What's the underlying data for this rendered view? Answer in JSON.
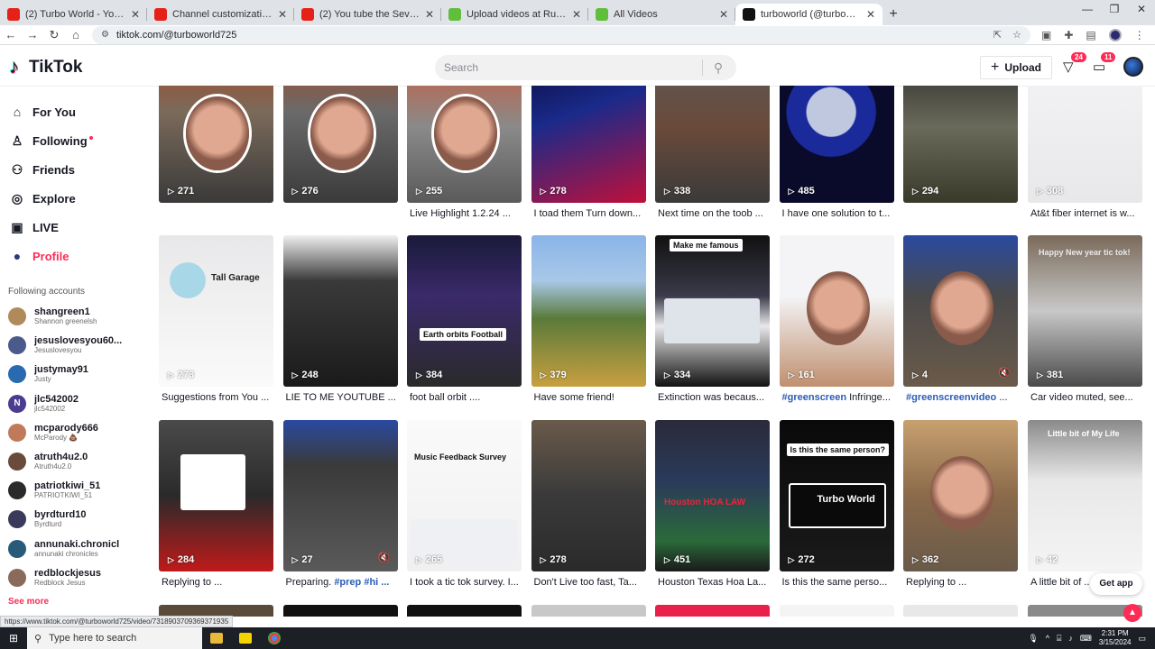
{
  "browser": {
    "tabs": [
      {
        "title": "(2) Turbo World - YouTube",
        "color": "#e62117"
      },
      {
        "title": "Channel customization - YouTube",
        "color": "#e62117"
      },
      {
        "title": "(2) You tube the Severe alcohol",
        "color": "#e62117"
      },
      {
        "title": "Upload videos at Rumble",
        "color": "#5fbf3c"
      },
      {
        "title": "All Videos",
        "color": "#5fbf3c"
      },
      {
        "title": "turboworld (@turboworld725) | TikTok",
        "color": "#111111"
      }
    ],
    "active_tab": 5,
    "url": "tiktok.com/@turboworld725"
  },
  "header": {
    "logo": "TikTok",
    "search_placeholder": "Search",
    "upload_label": "Upload",
    "inbox_badge": "24",
    "messages_badge": "11"
  },
  "sidebar": {
    "nav": [
      {
        "label": "For You",
        "icon": "home-icon"
      },
      {
        "label": "Following",
        "icon": "following-icon"
      },
      {
        "label": "Friends",
        "icon": "friends-icon"
      },
      {
        "label": "Explore",
        "icon": "compass-icon"
      },
      {
        "label": "LIVE",
        "icon": "live-icon"
      },
      {
        "label": "Profile",
        "icon": "profile-icon"
      }
    ],
    "following_title": "Following accounts",
    "accounts": [
      {
        "name": "shangreen1",
        "sub": "Shannon greenelsh",
        "color": "#b08a5a"
      },
      {
        "name": "jesuslovesyou60...",
        "sub": "Jesuslovesyou",
        "color": "#4a5a8a"
      },
      {
        "name": "justymay91",
        "sub": "Justy",
        "color": "#2a6ab0"
      },
      {
        "name": "jlc542002",
        "sub": "jlc542002",
        "color": "#4b3c8f",
        "initial": "N"
      },
      {
        "name": "mcparody666",
        "sub": "McParody 💩",
        "color": "#c07a5a"
      },
      {
        "name": "atruth4u2.0",
        "sub": "Atruth4u2.0",
        "color": "#6a4a3a"
      },
      {
        "name": "patriotkiwi_51",
        "sub": "PATRIOTKIWI_51",
        "color": "#2a2a2a"
      },
      {
        "name": "byrdturd10",
        "sub": "Byrdturd",
        "color": "#3a3a5a"
      },
      {
        "name": "annunaki.chronicl",
        "sub": "annunaki chronicles",
        "color": "#2a5a7a"
      },
      {
        "name": "redblockjesus",
        "sub": "Redblock Jesus",
        "color": "#8a6a5a"
      }
    ],
    "see_more": "See more"
  },
  "videos": [
    {
      "views": "271",
      "caption": ""
    },
    {
      "views": "276",
      "caption": ""
    },
    {
      "views": "255",
      "caption": "Live Highlight 1.2.24 ..."
    },
    {
      "views": "278",
      "caption": "I toad them Turn down..."
    },
    {
      "views": "338",
      "caption": "Next time on the toob ..."
    },
    {
      "views": "485",
      "caption": "I have one solution to t..."
    },
    {
      "views": "294",
      "caption": ""
    },
    {
      "views": "308",
      "caption": "At&t fiber internet is w..."
    },
    {
      "views": "273",
      "caption": "Suggestions from You ...",
      "overlay": "Tall Garage"
    },
    {
      "views": "248",
      "caption": "LIE TO ME YOUTUBE ..."
    },
    {
      "views": "384",
      "caption": "foot ball orbit ....",
      "overlay": "Earth orbits Football"
    },
    {
      "views": "379",
      "caption": "Have some friend!"
    },
    {
      "views": "334",
      "caption": "Extinction was becaus...",
      "overlay": "Make me famous"
    },
    {
      "views": "161",
      "tag": "#greenscreen",
      "caption": " Infringe..."
    },
    {
      "views": "4",
      "tag": "#greenscreenvideo",
      "caption": " ..."
    },
    {
      "views": "381",
      "caption": "Car video muted, see...",
      "overlay": "Happy New year tic tok!"
    },
    {
      "views": "284",
      "caption": "Replying to ..."
    },
    {
      "views": "27",
      "caption": "Preparing. ",
      "tag": "#prep #hi ..."
    },
    {
      "views": "265",
      "caption": "I took a tic tok survey. I...",
      "overlay": "Music Feedback Survey"
    },
    {
      "views": "278",
      "caption": "Don't Live too fast, Ta..."
    },
    {
      "views": "451",
      "caption": "Houston Texas Hoa La...",
      "overlay": "Houston HOA LAW"
    },
    {
      "views": "272",
      "caption": "Is this the same perso...",
      "overlay": "Is this the same person?",
      "overlay2": "Turbo World"
    },
    {
      "views": "362",
      "caption": "Replying to ..."
    },
    {
      "views": "42",
      "caption": "A little bit of ...",
      "overlay": "Little bit of My Life"
    }
  ],
  "get_app": "Get app",
  "status_url": "https://www.tiktok.com/@turboworld725/video/7318903709369371935",
  "taskbar": {
    "search_placeholder": "Type here to search",
    "time": "2:31 PM",
    "date": "3/15/2024"
  },
  "colors": {
    "accent": "#fe2c55",
    "hashtag": "#2b5db6"
  }
}
